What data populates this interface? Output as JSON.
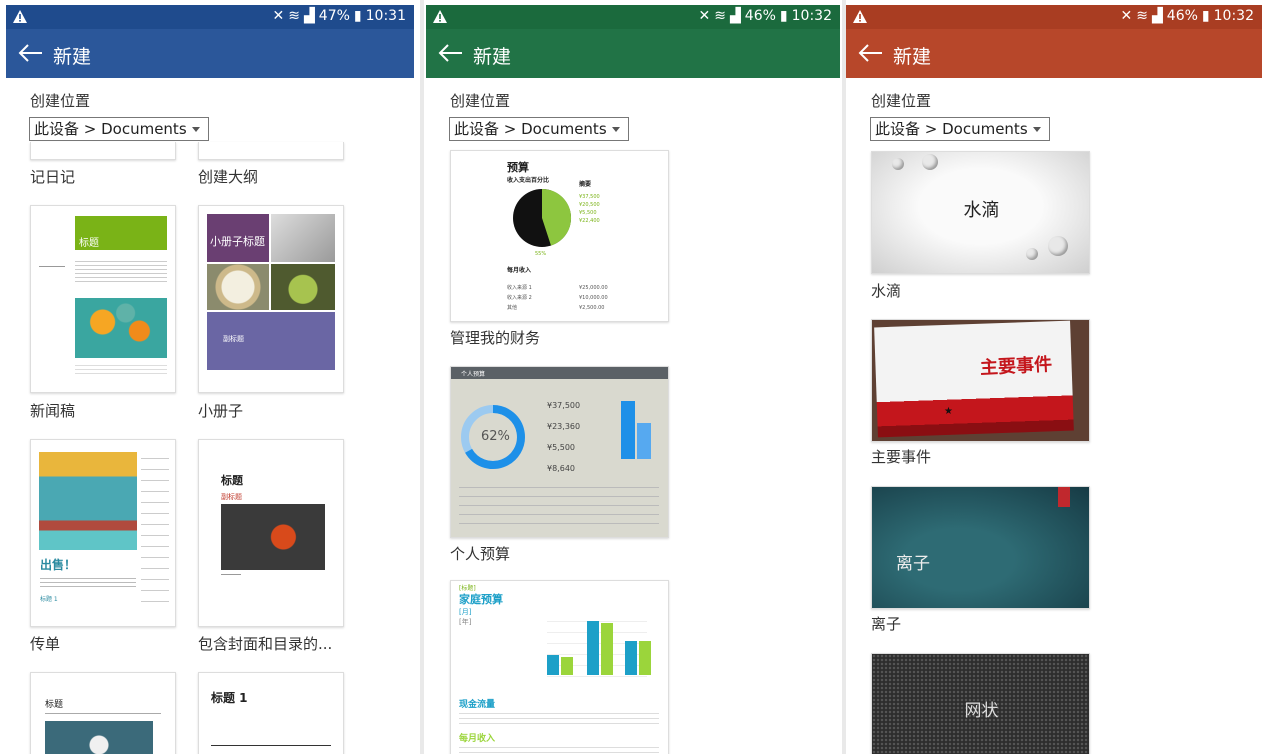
{
  "status": {
    "p1": {
      "battery": "47%",
      "time": "10:31"
    },
    "p2": {
      "battery": "46%",
      "time": "10:32"
    },
    "p3": {
      "battery": "46%",
      "time": "10:32"
    }
  },
  "appbar_title": "新建",
  "location_label": "创建位置",
  "location_value": "此设备 > Documents",
  "colors": {
    "word": "#2b579a",
    "excel": "#217346",
    "powerpoint": "#b7472a"
  },
  "word": {
    "templates": [
      "记日记",
      "创建大纲",
      "新闻稿",
      "小册子",
      "传单",
      "包含封面和目录的..."
    ],
    "thumb_text": {
      "news_title": "标题",
      "brochure_title": "小册子标题",
      "brochure_sub": "副标题",
      "flyer_title": "出售！",
      "flyer_h1": "标题 1",
      "toc_title": "标题",
      "toc_sub": "副标题",
      "bottom_a_title": "标题",
      "bottom_b_title": "标题 1"
    }
  },
  "excel": {
    "templates": [
      "管理我的财务",
      "个人预算"
    ],
    "budget": {
      "title": "预算",
      "subtitle": "收入支出百分比",
      "summary_label": "摘要",
      "pct": "55%",
      "summary_values": [
        "¥37,500",
        "¥20,500",
        "¥5,500",
        "¥22,400"
      ],
      "monthly": "每月收入",
      "rows": [
        {
          "label": "收入来源 1",
          "value": "¥25,000.00"
        },
        {
          "label": "收入来源 2",
          "value": "¥10,000.00"
        },
        {
          "label": "其他",
          "value": "¥2,500.00"
        }
      ]
    },
    "personal": {
      "header": "个人预算",
      "pct": "62%",
      "values": [
        "¥37,500",
        "¥23,360",
        "¥5,500",
        "¥8,640"
      ]
    },
    "family": {
      "tag": "[标题]",
      "title": "家庭预算",
      "month": "[月]",
      "year": "[年]",
      "cash": "现金流量",
      "monthly": "每月收入"
    }
  },
  "powerpoint": {
    "templates": [
      "水滴",
      "主要事件",
      "离子"
    ],
    "thumb_text": [
      "水滴",
      "主要事件",
      "离子",
      "网状"
    ]
  }
}
